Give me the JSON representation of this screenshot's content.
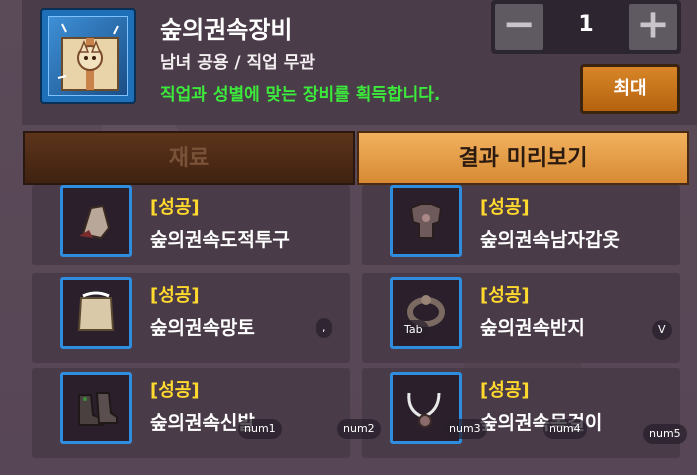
{
  "item": {
    "title": "숲의권속장비",
    "subtitle": "남녀 공용 / 직업 무관",
    "description": "직업과 성별에 맞는 장비를 획득합니다."
  },
  "stepper": {
    "minus_label": "−",
    "plus_label": "+",
    "quantity": "1"
  },
  "max_button": "최대",
  "tabs": {
    "material": "재료",
    "preview": "결과 미리보기"
  },
  "results": [
    {
      "status": "[성공]",
      "name": "숲의권속도적투구",
      "icon": "helmet-icon"
    },
    {
      "status": "[성공]",
      "name": "숲의권속남자갑옷",
      "icon": "armor-icon"
    },
    {
      "status": "[성공]",
      "name": "숲의권속망토",
      "icon": "cape-icon"
    },
    {
      "status": "[성공]",
      "name": "숲의권속반지",
      "icon": "ring-icon"
    },
    {
      "status": "[성공]",
      "name": "숲의권속신발",
      "icon": "boots-icon"
    },
    {
      "status": "[성공]",
      "name": "숲의권속목걸이",
      "icon": "necklace-icon"
    }
  ],
  "key_hints": [
    "Tab",
    "V",
    "num1",
    "num2",
    "num3",
    "num4",
    "num5",
    ","
  ]
}
